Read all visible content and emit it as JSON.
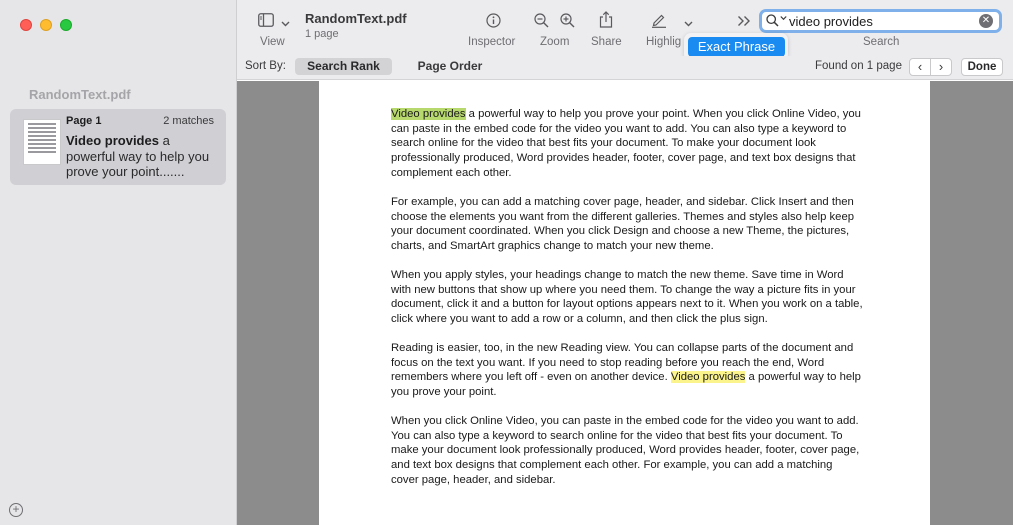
{
  "window": {
    "doc_title": "RandomText.pdf",
    "doc_pages": "1 page"
  },
  "toolbar": {
    "view_label": "View",
    "inspector_label": "Inspector",
    "zoom_label": "Zoom",
    "share_label": "Share",
    "highlight_label": "Highlig",
    "search_label": "Search"
  },
  "search": {
    "query": "video provides",
    "exact_phrase_label": "Exact Phrase",
    "sort_by_label": "Sort By:",
    "sort_options": [
      "Search Rank",
      "Page Order"
    ],
    "sort_selected": "Search Rank",
    "found_text": "Found on 1 page",
    "done_label": "Done"
  },
  "sidebar": {
    "doc_title": "RandomText.pdf",
    "results": [
      {
        "page_label": "Page 1",
        "count_label": "2 matches",
        "snippet_bold": "Video provides",
        "snippet_rest": " a powerful way to help you prove your point.......",
        "selected": true
      }
    ]
  },
  "document": {
    "paragraphs": [
      {
        "before": "",
        "match": "Video provides",
        "match_current": true,
        "after": " a powerful way to help you prove your point. When you click Online Video, you can paste in the embed code for the video you want to add. You can also type a keyword to search online for the video that best fits your document. To make your document look professionally produced, Word provides header, footer, cover page, and text box designs that complement each other."
      },
      {
        "before": "For example, you can add a matching cover page, header, and sidebar. Click Insert and then choose the elements you want from the different galleries. Themes and styles also help keep your document coordinated. When you click Design and choose a new Theme, the pictures, charts, and SmartArt graphics change to match your new theme.",
        "match": "",
        "after": ""
      },
      {
        "before": "When you apply styles, your headings change to match the new theme. Save time in Word with new buttons that show up where you need them. To change the way a picture fits in your document, click it and a button for layout options appears next to it. When you work on a table, click where you want to add a row or a column, and then click the plus sign.",
        "match": "",
        "after": ""
      },
      {
        "before": "Reading is easier, too, in the new Reading view. You can collapse parts of the document and focus on the text you want. If you need to stop reading before you reach the end, Word remembers where you left off - even on another device. ",
        "match": "Video provides",
        "match_current": false,
        "after": " a powerful way to help you prove your point."
      },
      {
        "before": "When you click Online Video, you can paste in the embed code for the video you want to add. You can also type a keyword to search online for the video that best fits your document. To make your document look professionally produced, Word provides header, footer, cover page, and text box designs that complement each other. For example, you can add a matching cover page, header, and sidebar.",
        "match": "",
        "after": ""
      }
    ]
  },
  "colors": {
    "current_match_highlight": "#b7d86d",
    "match_highlight": "#fbf38b",
    "accent": "#1a8bf0"
  },
  "icons": [
    "sidebar-view-icon",
    "chevron-down-icon",
    "info-icon",
    "zoom-out-icon",
    "zoom-in-icon",
    "share-icon",
    "highlight-pen-icon",
    "more-tools-icon",
    "search-icon",
    "clear-icon",
    "add-icon"
  ]
}
